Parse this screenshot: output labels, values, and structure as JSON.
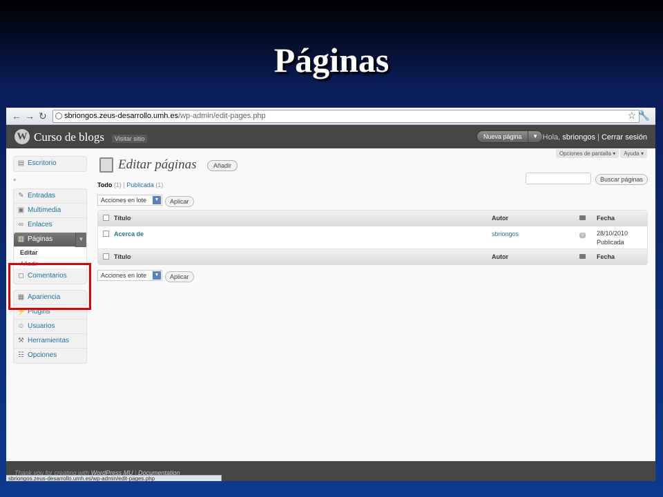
{
  "slide": {
    "title": "Páginas"
  },
  "browser": {
    "url_host": "sbriongos.zeus-desarrollo.umh.es",
    "url_path": "/wp-admin/edit-pages.php"
  },
  "header": {
    "site_name": "Curso de blogs",
    "visit_site": "Visitar sitio",
    "new_page": "Nueva página",
    "greeting": "Hola,",
    "username": "sbriongos",
    "separator": "|",
    "logout": "Cerrar sesión"
  },
  "screen_tabs": {
    "options": "Opciones de pantalla ▾",
    "help": "Ayuda ▾"
  },
  "menu": {
    "dashboard": "Escritorio",
    "posts": "Entradas",
    "media": "Multimedia",
    "links": "Enlaces",
    "pages": "Páginas",
    "pages_edit": "Editar",
    "pages_add": "Añadir",
    "comments": "Comentarios",
    "appearance": "Apariencia",
    "plugins": "Plugins",
    "users": "Usuarios",
    "tools": "Herramientas",
    "settings": "Opciones"
  },
  "main": {
    "heading": "Editar páginas",
    "add_button": "Añadir",
    "filter_all": "Todo",
    "filter_all_count": "(1)",
    "filter_sep": "|",
    "filter_published": "Publicada",
    "filter_published_count": "(1)",
    "search_button": "Buscar páginas",
    "bulk_actions": "Acciones en lote",
    "apply": "Aplicar"
  },
  "table": {
    "col_title": "Título",
    "col_author": "Autor",
    "col_date": "Fecha",
    "rows": [
      {
        "title": "Acerca de",
        "author": "sbriongos",
        "comments": "0",
        "date": "28/10/2010",
        "status": "Publicada"
      }
    ]
  },
  "footer": {
    "thanks": "Thank you for creating with",
    "wpmu": "WordPress MU",
    "sep": "|",
    "docs": "Documentation"
  },
  "statusbar": {
    "text": "sbriongos.zeus-desarrollo.umh.es/wp-admin/edit-pages.php"
  }
}
